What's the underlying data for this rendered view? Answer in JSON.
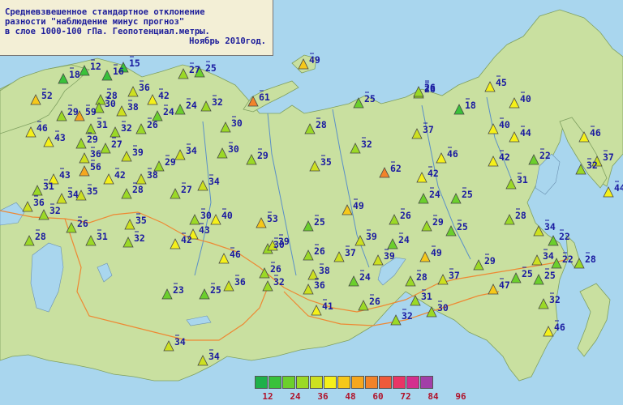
{
  "title": {
    "lines": [
      "Средневзвешенное стандартное отклонение",
      "разности \"наблюдение минус прогноз\"",
      "в слое 1000-100 гПа. Геопотенциал.метры.",
      "Ноябрь 2010год."
    ]
  },
  "legend": {
    "colors": [
      "#1fb04a",
      "#39c13a",
      "#6bcf2c",
      "#9bd926",
      "#cde020",
      "#f5f01a",
      "#f6c81a",
      "#f5a71e",
      "#f2832a",
      "#ee5a3a",
      "#e93566",
      "#d42e8e",
      "#a23fa8"
    ],
    "labels": [
      "12",
      "24",
      "36",
      "48",
      "60",
      "72",
      "84",
      "96"
    ]
  },
  "colors": {
    "sea": "#a9d6ee",
    "land": "#c9e0a0",
    "border": "#ee8833",
    "marker_edge": "#444444",
    "label": "#1a1aa0"
  },
  "stations": [
    {
      "v": "49"
    },
    {
      "v": "18"
    },
    {
      "v": "12"
    },
    {
      "v": "16"
    },
    {
      "v": "15"
    },
    {
      "v": "25"
    },
    {
      "v": "27"
    },
    {
      "v": "26"
    },
    {
      "v": "36"
    },
    {
      "v": "42"
    },
    {
      "v": "52"
    },
    {
      "v": "28"
    },
    {
      "v": "30"
    },
    {
      "v": "24"
    },
    {
      "v": "32"
    },
    {
      "v": "61"
    },
    {
      "v": "25"
    },
    {
      "v": "26"
    },
    {
      "v": "45"
    },
    {
      "v": "29"
    },
    {
      "v": "59"
    },
    {
      "v": "38"
    },
    {
      "v": "24"
    },
    {
      "v": "18"
    },
    {
      "v": "40"
    },
    {
      "v": "46"
    },
    {
      "v": "31"
    },
    {
      "v": "32"
    },
    {
      "v": "26"
    },
    {
      "v": "30"
    },
    {
      "v": "28"
    },
    {
      "v": "37"
    },
    {
      "v": "40"
    },
    {
      "v": "44"
    },
    {
      "v": "46"
    },
    {
      "v": "43"
    },
    {
      "v": "29"
    },
    {
      "v": "27"
    },
    {
      "v": "36"
    },
    {
      "v": "39"
    },
    {
      "v": "34"
    },
    {
      "v": "30"
    },
    {
      "v": "32"
    },
    {
      "v": "46"
    },
    {
      "v": "42"
    },
    {
      "v": "22"
    },
    {
      "v": "37"
    },
    {
      "v": "29"
    },
    {
      "v": "56"
    },
    {
      "v": "43"
    },
    {
      "v": "42"
    },
    {
      "v": "38"
    },
    {
      "v": "29"
    },
    {
      "v": "35"
    },
    {
      "v": "62"
    },
    {
      "v": "42"
    },
    {
      "v": "32"
    },
    {
      "v": "31"
    },
    {
      "v": "34"
    },
    {
      "v": "35"
    },
    {
      "v": "28"
    },
    {
      "v": "27"
    },
    {
      "v": "34"
    },
    {
      "v": "31"
    },
    {
      "v": "24"
    },
    {
      "v": "25"
    },
    {
      "v": "44"
    },
    {
      "v": "36"
    },
    {
      "v": "32"
    },
    {
      "v": "49"
    },
    {
      "v": "30"
    },
    {
      "v": "26"
    },
    {
      "v": "26"
    },
    {
      "v": "40"
    },
    {
      "v": "53"
    },
    {
      "v": "25"
    },
    {
      "v": "29"
    },
    {
      "v": "28"
    },
    {
      "v": "35"
    },
    {
      "v": "34"
    },
    {
      "v": "22"
    },
    {
      "v": "28"
    },
    {
      "v": "31"
    },
    {
      "v": "32"
    },
    {
      "v": "42"
    },
    {
      "v": "43"
    },
    {
      "v": "39"
    },
    {
      "v": "24"
    },
    {
      "v": "30"
    },
    {
      "v": "25"
    },
    {
      "v": "39"
    },
    {
      "v": "46"
    },
    {
      "v": "26"
    },
    {
      "v": "37"
    },
    {
      "v": "39"
    },
    {
      "v": "49"
    },
    {
      "v": "29"
    },
    {
      "v": "34"
    },
    {
      "v": "22"
    },
    {
      "v": "28"
    },
    {
      "v": "25"
    },
    {
      "v": "38"
    },
    {
      "v": "26"
    },
    {
      "v": "28"
    },
    {
      "v": "37"
    },
    {
      "v": "25"
    },
    {
      "v": "24"
    },
    {
      "v": "23"
    },
    {
      "v": "25"
    },
    {
      "v": "36"
    },
    {
      "v": "32"
    },
    {
      "v": "36"
    },
    {
      "v": "34"
    },
    {
      "v": "47"
    },
    {
      "v": "31"
    },
    {
      "v": "41"
    },
    {
      "v": "26"
    },
    {
      "v": "30"
    },
    {
      "v": "32"
    },
    {
      "v": "32"
    },
    {
      "v": "46"
    },
    {
      "v": "34"
    },
    {
      "v": "46"
    }
  ]
}
